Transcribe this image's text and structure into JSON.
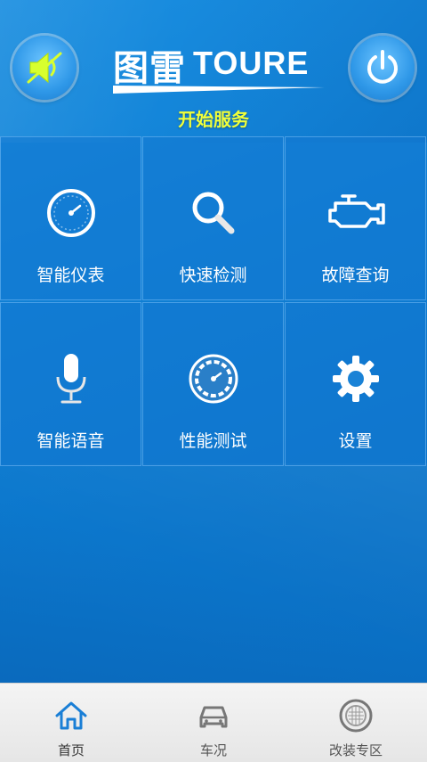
{
  "header": {
    "logo_cn": "图雷",
    "logo_en": "TOURE",
    "start_service": "开始服务"
  },
  "icons": {
    "sound": "speaker-muted-icon",
    "power": "power-icon"
  },
  "menu": [
    {
      "label": "智能仪表",
      "icon": "gauge-icon"
    },
    {
      "label": "快速检测",
      "icon": "magnifier-icon"
    },
    {
      "label": "故障查询",
      "icon": "engine-icon"
    },
    {
      "label": "智能语音",
      "icon": "microphone-icon"
    },
    {
      "label": "性能测试",
      "icon": "speedometer-icon"
    },
    {
      "label": "设置",
      "icon": "gear-icon"
    }
  ],
  "tabs": [
    {
      "label": "首页",
      "icon": "home-icon",
      "active": true
    },
    {
      "label": "车况",
      "icon": "car-icon",
      "active": false
    },
    {
      "label": "改装专区",
      "icon": "speaker-grille-icon",
      "active": false
    }
  ],
  "colors": {
    "accent_yellow": "#f0ff3a",
    "background_blue": "#0f7fd4",
    "tab_active": "#1a7fd6"
  }
}
